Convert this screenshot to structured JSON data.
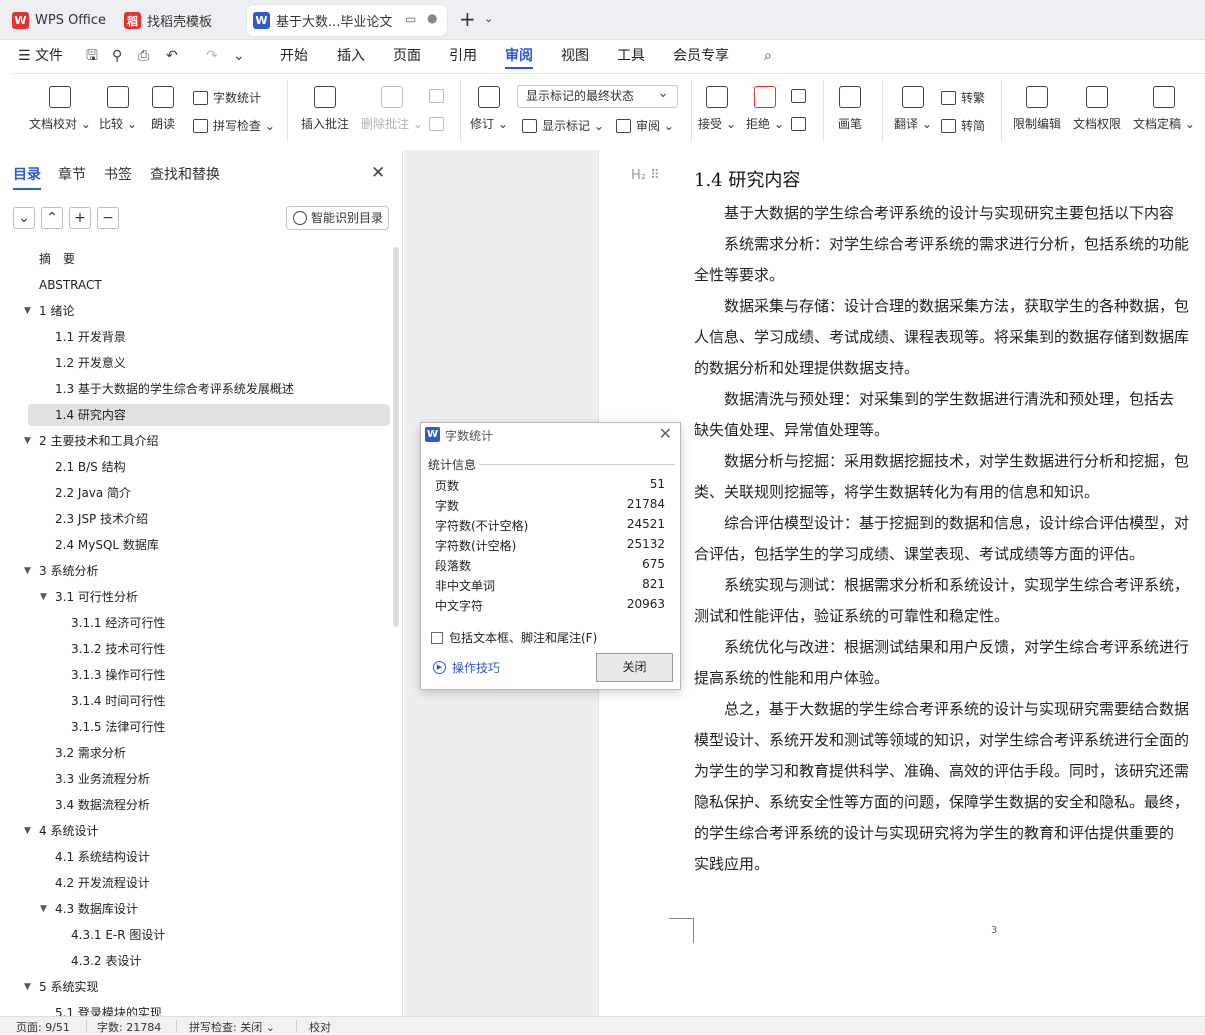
{
  "tabs": [
    {
      "label": "WPS Office",
      "icon": "wps-logo-icon"
    },
    {
      "label": "找稻壳模板",
      "icon": "docer-logo-icon"
    },
    {
      "label": "基于大数...毕业论文",
      "icon": "word-doc-icon"
    }
  ],
  "menu": {
    "file": "文件",
    "items": [
      "开始",
      "插入",
      "页面",
      "引用",
      "审阅",
      "视图",
      "工具",
      "会员专享"
    ],
    "active": "审阅"
  },
  "ribbon": {
    "doc_check": "文档校对",
    "compare": "比较",
    "read_aloud": "朗读",
    "word_count": "字数统计",
    "spell_check": "拼写检查",
    "insert_comment": "插入批注",
    "delete_comment": "删除批注",
    "revise": "修订",
    "markup_select": "显示标记的最终状态",
    "show_markup": "显示标记",
    "review": "审阅",
    "accept": "接受",
    "reject": "拒绝",
    "pen": "画笔",
    "translate": "翻译",
    "to_traditional": "转繁",
    "to_simplified": "转简",
    "restrict_edit": "限制编辑",
    "doc_permission": "文档权限",
    "doc_finalize": "文档定稿"
  },
  "sidebar": {
    "tabs": [
      "目录",
      "章节",
      "书签",
      "查找和替换"
    ],
    "smart_btn": "智能识别目录",
    "toc": [
      {
        "label": "摘　要",
        "level": 1,
        "arrow": ""
      },
      {
        "label": "ABSTRACT",
        "level": 1,
        "arrow": ""
      },
      {
        "label": "1  绪论",
        "level": 1,
        "arrow": "▼"
      },
      {
        "label": "1.1 开发背景",
        "level": 2,
        "arrow": ""
      },
      {
        "label": "1.2 开发意义",
        "level": 2,
        "arrow": ""
      },
      {
        "label": "1.3 基于大数据的学生综合考评系统发展概述",
        "level": 2,
        "arrow": ""
      },
      {
        "label": "1.4 研究内容",
        "level": 2,
        "arrow": "",
        "selected": true
      },
      {
        "label": "2  主要技术和工具介绍",
        "level": 1,
        "arrow": "▼"
      },
      {
        "label": "2.1 B/S 结构",
        "level": 2,
        "arrow": ""
      },
      {
        "label": "2.2 Java 简介",
        "level": 2,
        "arrow": ""
      },
      {
        "label": "2.3 JSP 技术介绍",
        "level": 2,
        "arrow": ""
      },
      {
        "label": "2.4 MySQL 数据库",
        "level": 2,
        "arrow": ""
      },
      {
        "label": "3  系统分析",
        "level": 1,
        "arrow": "▼"
      },
      {
        "label": "3.1 可行性分析",
        "level": 2,
        "arrow": "▼"
      },
      {
        "label": "3.1.1 经济可行性",
        "level": 3,
        "arrow": ""
      },
      {
        "label": "3.1.2 技术可行性",
        "level": 3,
        "arrow": ""
      },
      {
        "label": "3.1.3 操作可行性",
        "level": 3,
        "arrow": ""
      },
      {
        "label": "3.1.4  时间可行性",
        "level": 3,
        "arrow": ""
      },
      {
        "label": "3.1.5  法律可行性",
        "level": 3,
        "arrow": ""
      },
      {
        "label": "3.2 需求分析",
        "level": 2,
        "arrow": ""
      },
      {
        "label": "3.3 业务流程分析",
        "level": 2,
        "arrow": ""
      },
      {
        "label": "3.4 数据流程分析",
        "level": 2,
        "arrow": ""
      },
      {
        "label": "4  系统设计",
        "level": 1,
        "arrow": "▼"
      },
      {
        "label": "4.1 系统结构设计",
        "level": 2,
        "arrow": ""
      },
      {
        "label": "4.2 开发流程设计",
        "level": 2,
        "arrow": ""
      },
      {
        "label": "4.3 数据库设计",
        "level": 2,
        "arrow": "▼"
      },
      {
        "label": "4.3.1 E-R 图设计",
        "level": 3,
        "arrow": ""
      },
      {
        "label": "4.3.2 表设计",
        "level": 3,
        "arrow": ""
      },
      {
        "label": "5  系统实现",
        "level": 1,
        "arrow": "▼"
      },
      {
        "label": "5.1 登录模块的实现",
        "level": 2,
        "arrow": ""
      }
    ]
  },
  "document": {
    "heading_marker": "H₂ ⠿",
    "title": "1.4 研究内容",
    "lines": [
      "　　基于大数据的学生综合考评系统的设计与实现研究主要包括以下内容",
      "　　系统需求分析：对学生综合考评系统的需求进行分析，包括系统的功能",
      "全性等要求。",
      "　　数据采集与存储：设计合理的数据采集方法，获取学生的各种数据，包",
      "人信息、学习成绩、考试成绩、课程表现等。将采集到的数据存储到数据库",
      "的数据分析和处理提供数据支持。",
      "　　数据清洗与预处理：对采集到的学生数据进行清洗和预处理，包括去",
      "缺失值处理、异常值处理等。",
      "　　数据分析与挖掘：采用数据挖掘技术，对学生数据进行分析和挖掘，包",
      "类、关联规则挖掘等，将学生数据转化为有用的信息和知识。",
      "　　综合评估模型设计：基于挖掘到的数据和信息，设计综合评估模型，对",
      "合评估，包括学生的学习成绩、课堂表现、考试成绩等方面的评估。",
      "　　系统实现与测试：根据需求分析和系统设计，实现学生综合考评系统，",
      "测试和性能评估，验证系统的可靠性和稳定性。",
      "　　系统优化与改进：根据测试结果和用户反馈，对学生综合考评系统进行",
      "提高系统的性能和用户体验。",
      "　　总之，基于大数据的学生综合考评系统的设计与实现研究需要结合数据",
      "模型设计、系统开发和测试等领域的知识，对学生综合考评系统进行全面的",
      "为学生的学习和教育提供科学、准确、高效的评估手段。同时，该研究还需",
      "隐私保护、系统安全性等方面的问题，保障学生数据的安全和隐私。最终，",
      "的学生综合考评系统的设计与实现研究将为学生的教育和评估提供重要的",
      "实践应用。"
    ],
    "page_number": "3"
  },
  "dialog": {
    "title": "字数统计",
    "group": "统计信息",
    "stats": [
      {
        "label": "页数",
        "value": "51"
      },
      {
        "label": "字数",
        "value": "21784"
      },
      {
        "label": "字符数(不计空格)",
        "value": "24521"
      },
      {
        "label": "字符数(计空格)",
        "value": "25132"
      },
      {
        "label": "段落数",
        "value": "675"
      },
      {
        "label": "非中文单词",
        "value": "821"
      },
      {
        "label": "中文字符",
        "value": "20963"
      }
    ],
    "checkbox": "包括文本框、脚注和尾注(F)",
    "tips": "操作技巧",
    "close": "关闭"
  },
  "status": {
    "page": "页面: 9/51",
    "words": "字数: 21784",
    "spell": "拼写检查: 关闭 ⌄",
    "proof": "校对"
  },
  "colors": {
    "accent": "#2f5bd2",
    "wps_red": "#e7322f"
  }
}
